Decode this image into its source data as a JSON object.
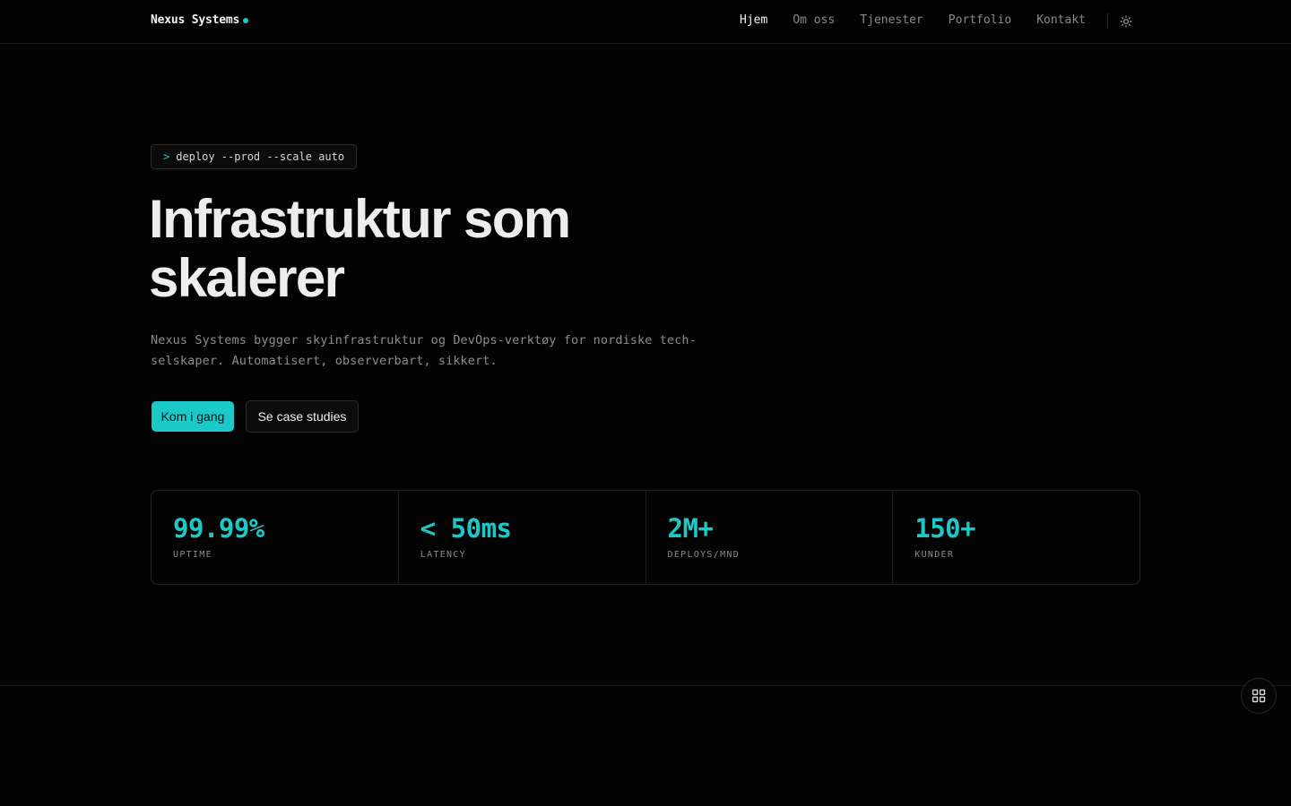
{
  "header": {
    "logo_text": "Nexus Systems",
    "accent_color": "#1cc9c9",
    "nav": [
      {
        "label": "Hjem",
        "active": true
      },
      {
        "label": "Om oss",
        "active": false
      },
      {
        "label": "Tjenester",
        "active": false
      },
      {
        "label": "Portfolio",
        "active": false
      },
      {
        "label": "Kontakt",
        "active": false
      }
    ],
    "theme_icon": "sun-icon"
  },
  "hero": {
    "command_prompt": ">",
    "command_text": "deploy --prod --scale auto",
    "title_line1": "Infrastruktur som",
    "title_line2": "skalerer",
    "subtitle": "Nexus Systems bygger skyinfrastruktur og DevOps-verktøy for nordiske tech-selskaper. Automatisert, observerbart, sikkert.",
    "primary_button": "Kom i gang",
    "secondary_button": "Se case studies"
  },
  "stats": [
    {
      "value": "99.99%",
      "label": "UPTIME"
    },
    {
      "value": "< 50ms",
      "label": "LATENCY"
    },
    {
      "value": "2M+",
      "label": "DEPLOYS/MND"
    },
    {
      "value": "150+",
      "label": "KUNDER"
    }
  ],
  "floating_button_icon": "grid-icon"
}
